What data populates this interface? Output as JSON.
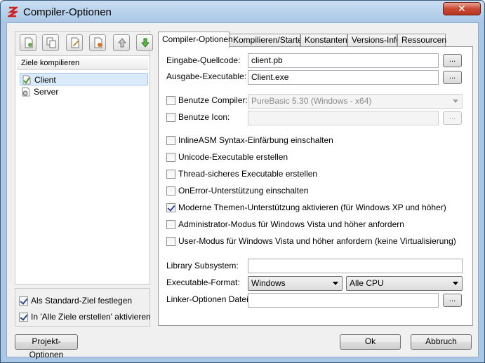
{
  "window": {
    "title": "Compiler-Optionen",
    "close_label": "✕"
  },
  "left_panel": {
    "toolbar": [
      {
        "name": "new-target-button",
        "icon": "new-target-icon",
        "color": "#6aa84f"
      },
      {
        "name": "copy-target-button",
        "icon": "copy-icon",
        "color": "#888888"
      },
      {
        "name": "edit-target-button",
        "icon": "edit-icon",
        "color": "#e0a020"
      },
      {
        "name": "remove-target-button",
        "icon": "remove-icon",
        "color": "#e07020"
      },
      {
        "name": "move-up-button",
        "icon": "arrow-up-icon",
        "color": "#888888"
      },
      {
        "name": "move-down-button",
        "icon": "arrow-down-icon",
        "color": "#3a9a2a"
      }
    ],
    "list_header": "Ziele kompilieren",
    "targets": [
      {
        "label": "Client",
        "icon": "checkmark-doc-icon",
        "selected": true
      },
      {
        "label": "Server",
        "icon": "gear-doc-icon",
        "selected": false
      }
    ],
    "default_target_label": "Als Standard-Ziel festlegen",
    "default_target_checked": true,
    "build_all_label": "In 'Alle Ziele erstellen' aktivieren",
    "build_all_checked": true
  },
  "tabs": [
    {
      "label": "Compiler-Optionen",
      "active": true
    },
    {
      "label": "Kompilieren/Starten",
      "active": false
    },
    {
      "label": "Konstanten",
      "active": false
    },
    {
      "label": "Versions-Info",
      "active": false
    },
    {
      "label": "Ressourcen",
      "active": false
    }
  ],
  "compiler_options": {
    "source_label": "Eingabe-Quellcode:",
    "source_value": "client.pb",
    "output_label": "Ausgabe-Executable:",
    "output_value": "Client.exe",
    "browse_label": "...",
    "use_compiler_label": "Benutze Compiler:",
    "use_compiler_checked": false,
    "compiler_value": "PureBasic 5.30 (Windows - x64)",
    "use_icon_label": "Benutze Icon:",
    "use_icon_checked": false,
    "options": [
      {
        "label": "InlineASM Syntax-Einfärbung einschalten",
        "checked": false
      },
      {
        "label": "Unicode-Executable erstellen",
        "checked": false
      },
      {
        "label": "Thread-sicheres Executable erstellen",
        "checked": false
      },
      {
        "label": "OnError-Unterstützung einschalten",
        "checked": false
      },
      {
        "label": "Moderne Themen-Unterstützung aktivieren (für Windows XP und höher)",
        "checked": true
      },
      {
        "label": "Administrator-Modus für Windows Vista und höher anfordern",
        "checked": false
      },
      {
        "label": "User-Modus für Windows Vista und höher anfordern (keine Virtualisierung)",
        "checked": false
      }
    ],
    "library_subsystem_label": "Library Subsystem:",
    "library_subsystem_value": "",
    "exe_format_label": "Executable-Format:",
    "exe_format_value": "Windows",
    "cpu_value": "Alle CPU",
    "linker_label": "Linker-Optionen Datei:",
    "linker_value": ""
  },
  "footer": {
    "project_options": "Projekt-Optionen",
    "ok": "Ok",
    "cancel": "Abbruch"
  }
}
